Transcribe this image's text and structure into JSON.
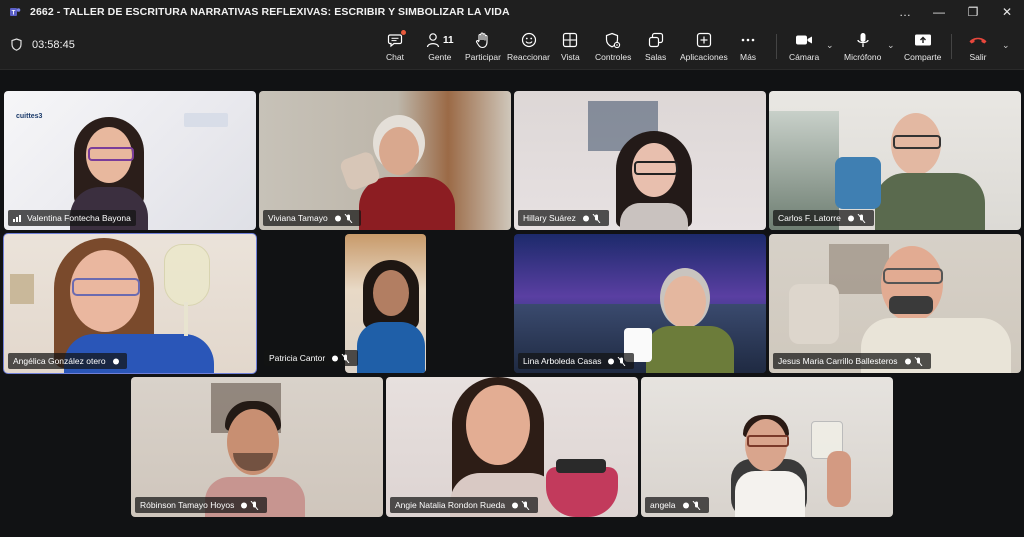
{
  "window": {
    "title": "2662 - TALLER DE ESCRITURA NARRATIVAS REFLEXIVAS: ESCRIBIR Y SIMBOLIZAR LA VIDA",
    "controls": [
      "…",
      "—",
      "❐",
      "✕"
    ]
  },
  "toolbar": {
    "timer": "03:58:45",
    "chat": "Chat",
    "people": "Gente",
    "people_count": "11",
    "raise": "Participar",
    "react": "Reaccionar",
    "view": "Vista",
    "controls": "Controles",
    "rooms": "Salas",
    "apps": "Aplicaciones",
    "more": "Más",
    "camera": "Cámara",
    "mic": "Micrófono",
    "share": "Comparte",
    "leave": "Salir"
  },
  "participants": [
    {
      "name": "Valentina Fontecha Bayona"
    },
    {
      "name": "Viviana Tamayo"
    },
    {
      "name": "Hillary Suárez"
    },
    {
      "name": "Carlos F. Latorre"
    },
    {
      "name": "Angélica González otero"
    },
    {
      "name": "Patricia Cantor"
    },
    {
      "name": "Lina Arboleda Casas"
    },
    {
      "name": "Jesus Maria Carrillo Ballesteros"
    },
    {
      "name": "Róbinson Tamayo Hoyos"
    },
    {
      "name": "Angie Natalia Rondon Rueda"
    },
    {
      "name": "angela"
    }
  ],
  "tile0_logo": "cuittes3",
  "colors": {
    "accent": "#6f7fd8",
    "leave": "#e8473c",
    "notify": "#e85a3c"
  }
}
